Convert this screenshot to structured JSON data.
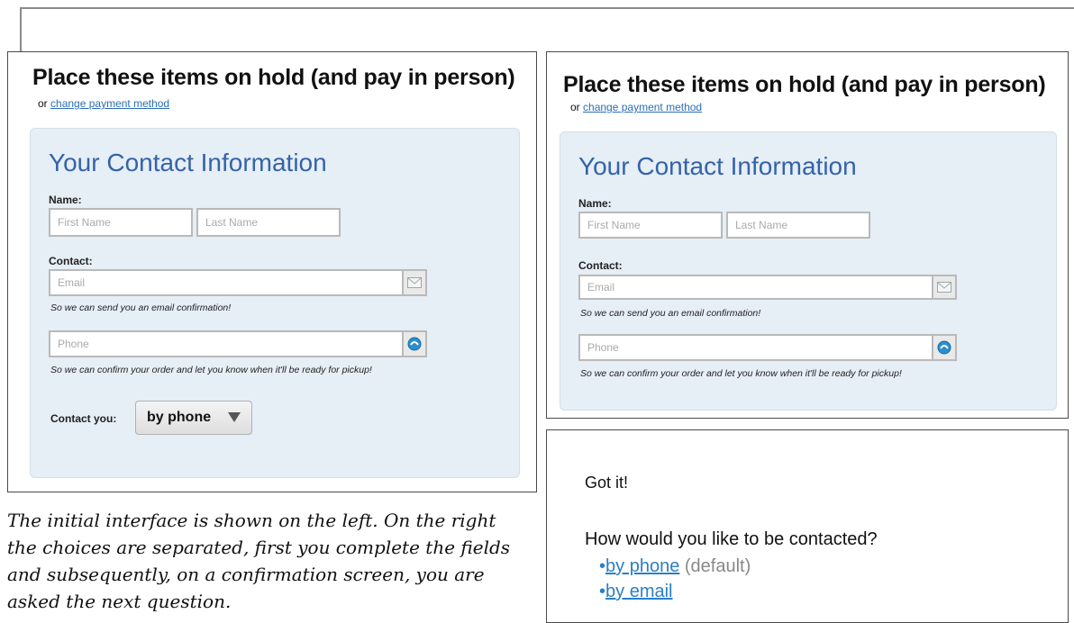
{
  "left_panel": {
    "title": "Place these items on hold (and pay in person)",
    "sub_prefix": "or",
    "sub_link": "change payment method",
    "heading": "Your Contact Information",
    "name_label": "Name:",
    "first_name_placeholder": "First Name",
    "last_name_placeholder": "Last Name",
    "contact_label": "Contact:",
    "email_placeholder": "Email",
    "email_help": "So we can send you an email confirmation!",
    "phone_placeholder": "Phone",
    "phone_help": "So we can confirm your order and let you know when it'll be ready for pickup!",
    "contact_you_label": "Contact you:",
    "contact_you_value": "by phone"
  },
  "right_panel": {
    "title": "Place these items on hold (and pay in person)",
    "sub_prefix": "or",
    "sub_link": "change payment method",
    "heading": "Your Contact Information",
    "name_label": "Name:",
    "first_name_placeholder": "First Name",
    "last_name_placeholder": "Last Name",
    "contact_label": "Contact:",
    "email_placeholder": "Email",
    "email_help": "So we can send you an email confirmation!",
    "phone_placeholder": "Phone",
    "phone_help": "So we can confirm your order and let you know when it'll be ready for pickup!"
  },
  "confirm_panel": {
    "got_it": "Got it!",
    "question": "How would you like to be contacted?",
    "options": [
      {
        "bullet": "•",
        "label": "by phone",
        "note": "(default)"
      },
      {
        "bullet": "•",
        "label": "by email",
        "note": ""
      }
    ]
  },
  "caption": "The initial interface is shown on the left. On the right the choices are separated, first you complete the fields and subsequently, on a confirmation screen, you are asked the next question.",
  "colors": {
    "accent": "#3463a8",
    "link": "#2b6fb3",
    "form_bg": "#e6eef6"
  },
  "icons": {
    "email": "envelope-icon",
    "phone": "phone-globe-icon",
    "dropdown": "dropdown-arrow-icon"
  }
}
